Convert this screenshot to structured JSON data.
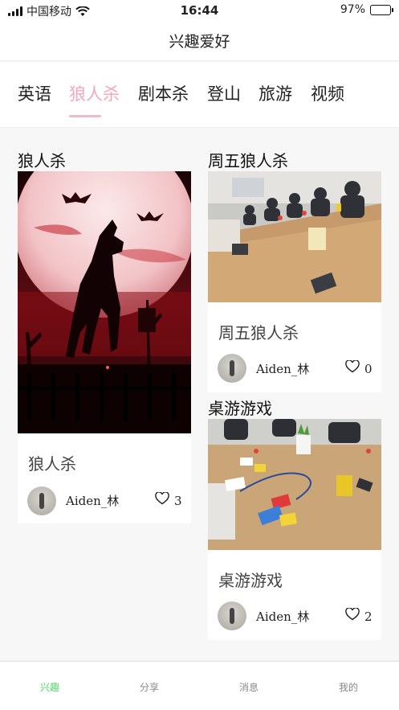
{
  "status_bar": {
    "carrier": "中国移动",
    "time": "16:44",
    "battery_text": "97%",
    "battery_level": 0.97
  },
  "header": {
    "title": "兴趣爱好"
  },
  "tabs": [
    {
      "label": "英语",
      "active": false
    },
    {
      "label": "狼人杀",
      "active": true
    },
    {
      "label": "剧本杀",
      "active": false
    },
    {
      "label": "登山",
      "active": false
    },
    {
      "label": "旅游",
      "active": false
    },
    {
      "label": "视频",
      "active": false
    }
  ],
  "accent_colors": {
    "active_tab": "#f5a8b8",
    "bottom_nav_active": "#4cd964"
  },
  "posts": [
    {
      "title": "狼人杀",
      "name": "狼人杀",
      "author": "Aiden_林",
      "likes": "3",
      "image": "wolf-moon-illustration"
    },
    {
      "title": "周五狼人杀",
      "name": "周五狼人杀",
      "author": "Aiden_林",
      "likes": "0",
      "image": "meeting-table-photo"
    },
    {
      "title": "桌游游戏",
      "name": "桌游游戏",
      "author": "Aiden_林",
      "likes": "2",
      "image": "uno-cards-table-photo"
    }
  ],
  "bottom_nav": [
    {
      "label": "兴趣",
      "active": true
    },
    {
      "label": "分享",
      "active": false
    },
    {
      "label": "消息",
      "active": false
    },
    {
      "label": "我的",
      "active": false
    }
  ]
}
